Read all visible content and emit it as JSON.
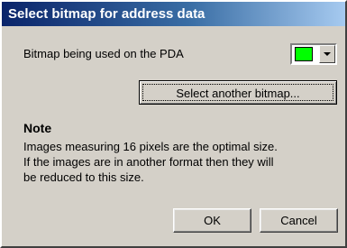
{
  "window": {
    "title": "Select bitmap for address data"
  },
  "bitmap": {
    "label": "Bitmap being used on the PDA",
    "current_color": "#00ff00"
  },
  "buttons": {
    "select_another": "Select another bitmap...",
    "ok": "OK",
    "cancel": "Cancel"
  },
  "note": {
    "heading": "Note",
    "lines": [
      "Images measuring 16 pixels are the optimal size.",
      "If the images are in another format then they will",
      "be reduced to this size."
    ]
  },
  "icons": {
    "dropdown": "chevron-down-icon"
  }
}
